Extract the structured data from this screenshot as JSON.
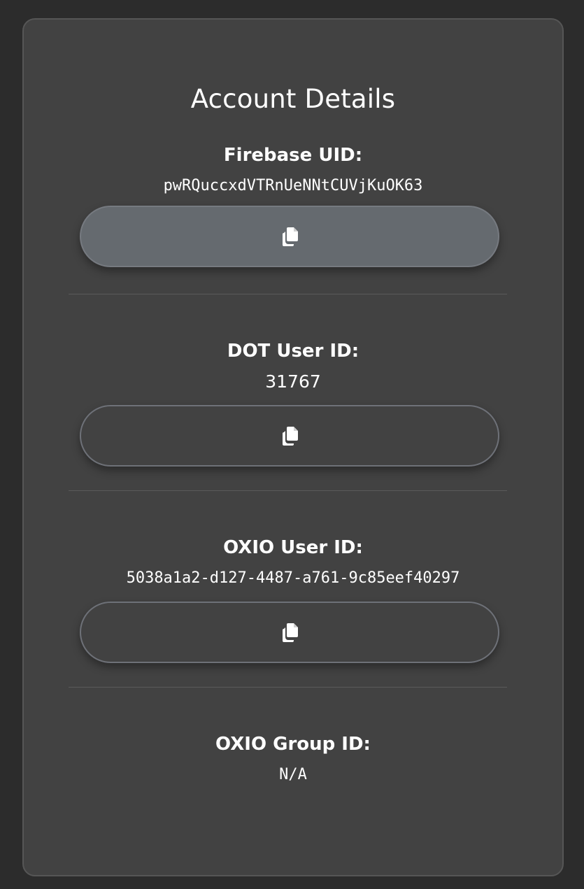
{
  "card": {
    "title": "Account Details"
  },
  "fields": [
    {
      "label": "Firebase UID:",
      "value": "pwRQuccxdVTRnUeNNtCUVjKuOK63",
      "copy_icon": "copy-icon"
    },
    {
      "label": "DOT User ID:",
      "value": "31767",
      "copy_icon": "copy-icon"
    },
    {
      "label": "OXIO User ID:",
      "value": "5038a1a2-d127-4487-a761-9c85eef40297",
      "copy_icon": "copy-icon"
    },
    {
      "label": "OXIO Group ID:",
      "value": "N/A"
    }
  ],
  "colors": {
    "page_background": "#2c2c2c",
    "card_background": "#424242",
    "active_button": "#656a6f",
    "button_border": "#6e7178",
    "text": "#ffffff"
  }
}
